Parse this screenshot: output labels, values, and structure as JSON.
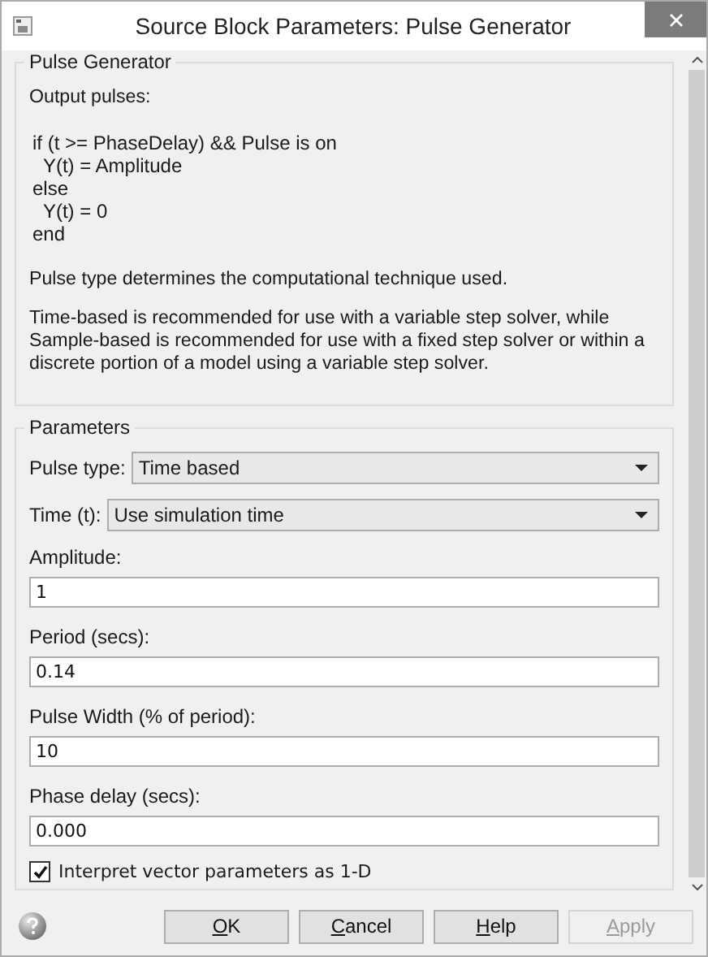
{
  "window": {
    "title": "Source Block Parameters: Pulse Generator"
  },
  "description": {
    "legend": "Pulse Generator",
    "lines": [
      "Output pulses:"
    ],
    "code": [
      "if (t >= PhaseDelay) && Pulse is on",
      "  Y(t) = Amplitude",
      "else",
      "  Y(t) = 0",
      "end"
    ],
    "paragraphs": [
      "Pulse type determines the computational technique used.",
      "Time-based is recommended for use with a variable step solver, while Sample-based is recommended for use with a fixed step solver or within a discrete portion of a model using a variable step solver."
    ]
  },
  "parameters": {
    "legend": "Parameters",
    "items": [
      {
        "kind": "dropdown",
        "label": "Pulse type:",
        "value": "Time based"
      },
      {
        "kind": "dropdown",
        "label": "Time (t):",
        "value": "Use simulation time"
      },
      {
        "kind": "text",
        "label": "Amplitude:",
        "value": "1"
      },
      {
        "kind": "text",
        "label": "Period (secs):",
        "value": "0.14"
      },
      {
        "kind": "text",
        "label": "Pulse Width (% of period):",
        "value": "10"
      },
      {
        "kind": "text",
        "label": "Phase delay (secs):",
        "value": "0.000"
      },
      {
        "kind": "checkbox",
        "label": "Interpret vector parameters as 1-D",
        "checked": true
      }
    ]
  },
  "buttons": [
    {
      "key": "O",
      "rest": "K",
      "disabled": false
    },
    {
      "key": "C",
      "rest": "ancel",
      "disabled": false
    },
    {
      "key": "H",
      "rest": "elp",
      "disabled": false
    },
    {
      "key": "A",
      "rest": "pply",
      "disabled": true
    }
  ]
}
